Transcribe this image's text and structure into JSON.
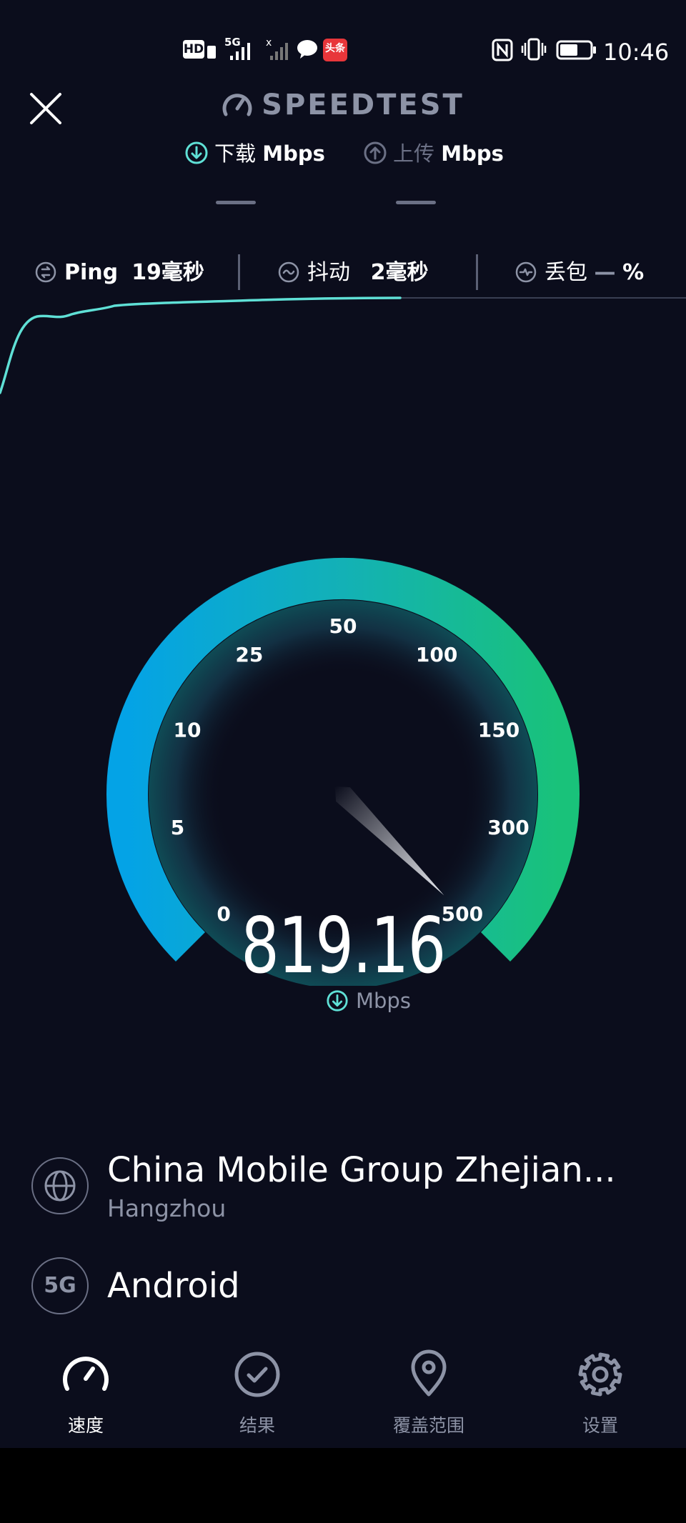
{
  "status_bar": {
    "network": "5G",
    "clock": "10:46",
    "app_badge": "头条"
  },
  "header": {
    "brand": "SPEEDTEST",
    "download_label": "下载",
    "download_unit": "Mbps",
    "upload_label": "上传",
    "upload_unit": "Mbps",
    "download_value": "—",
    "upload_value": "—"
  },
  "metrics": {
    "ping_label": "Ping",
    "ping_value": "19毫秒",
    "jitter_label": "抖动",
    "jitter_value": "2毫秒",
    "loss_label": "丢包",
    "loss_value": "—",
    "loss_unit": "%"
  },
  "gauge": {
    "ticks": [
      "0",
      "5",
      "10",
      "25",
      "50",
      "100",
      "150",
      "300",
      "500"
    ],
    "value": "819.16",
    "unit": "Mbps",
    "needle_reading": 500,
    "colors": {
      "start": "#04a3e6",
      "mid": "#13b1b6",
      "end": "#19c27a"
    }
  },
  "server": {
    "name": "China Mobile Group Zhejian...",
    "city": "Hangzhou"
  },
  "connection": {
    "badge": "5G",
    "name": "Android"
  },
  "nav": {
    "speed": "速度",
    "results": "结果",
    "coverage": "覆盖范围",
    "settings": "设置"
  },
  "colors": {
    "background": "#0b0d1c",
    "accent": "#5fe0d6",
    "muted": "#8d93a6"
  }
}
